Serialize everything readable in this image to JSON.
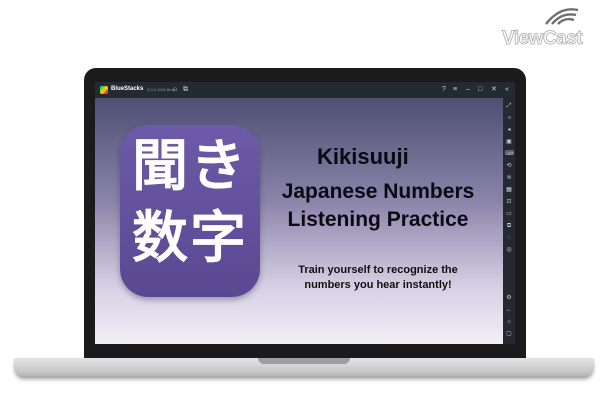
{
  "watermark": {
    "text": "ViewCast"
  },
  "emulator": {
    "name": "BlueStacks",
    "version": "5.0.0.1108 Beta"
  },
  "app": {
    "icon_kanji_line1": "聞き",
    "icon_kanji_line2": "数字",
    "title": "Kikisuuji",
    "subtitle_line1": "Japanese Numbers",
    "subtitle_line2": "Listening Practice",
    "tagline_line1": "Train yourself to recognize the",
    "tagline_line2": "numbers you hear instantly!"
  },
  "colors": {
    "icon_purple": "#6552a0",
    "toolbar_bg": "#252a31"
  }
}
